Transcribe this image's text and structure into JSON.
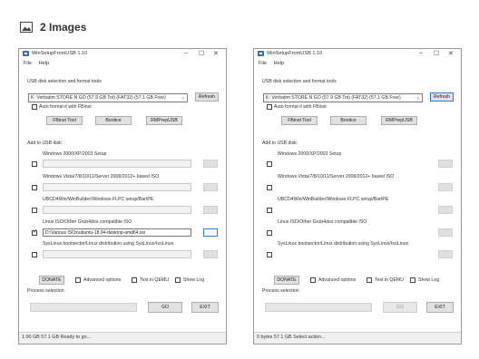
{
  "header": {
    "title": "2 Images",
    "icon": "image-gallery-icon"
  },
  "windows": [
    {
      "title": "WinSetupFromUSB 1.10",
      "menu": [
        "File",
        "Help"
      ],
      "disk_section_label": "USB disk selection and format tools",
      "disk_value": "K: Verbatim STORE N GO (57.9 GB Tot) (FAT32) (57.1 GB Free)",
      "refresh": "Refresh",
      "auto_format": "Auto format it with FBinst",
      "tools": [
        "FBinst Tool",
        "Bootice",
        "RMPrepUSB"
      ],
      "add_label": "Add to USB disk:",
      "options": [
        {
          "label": "Windows 2000/XP/2003 Setup",
          "value": "",
          "checked": false
        },
        {
          "label": "Windows Vista/7/8/10/11/Server 2008/2012+ based ISO",
          "value": "",
          "checked": false
        },
        {
          "label": "UBCD4Win/WinBuilder/Windows FLPC setup/BartPE",
          "value": "",
          "checked": false
        },
        {
          "label": "Linux ISO/Other Grub4dos compatible ISO",
          "value": "D:\\Various ISOs\\ubuntu-18.04-desktop-amd64.iso",
          "checked": true
        },
        {
          "label": "SysLinux bootsector/Linux distribution using SysLinux/IsoLinux",
          "value": "",
          "checked": false
        }
      ],
      "donate": "DONATE",
      "advanced": "Advanced options",
      "test_qemu": "Test in QEMU",
      "show_log": "Show Log",
      "process_label": "Process selection",
      "go": "GO",
      "exit": "EXIT",
      "status": "1.00 GB  57.1 GB  Ready to go..."
    },
    {
      "title": "WinSetupFromUSB 1.10",
      "menu": [
        "File",
        "Help"
      ],
      "disk_section_label": "USB disk selection and format tools",
      "disk_value": "K: Verbatim STORE N GO (57.9 GB Tot) (FAT32) (57.1 GB Free)",
      "refresh": "Refresh",
      "auto_format": "Auto format it with FBinst",
      "tools": [
        "FBinst Tool",
        "Bootice",
        "RMPrepUSB"
      ],
      "add_label": "Add to USB disk:",
      "options": [
        {
          "label": "Windows 2000/XP/2003 Setup",
          "value": "",
          "checked": false
        },
        {
          "label": "Windows Vista/7/8/10/11/Server 2008/2012+ based ISO",
          "value": "",
          "checked": false
        },
        {
          "label": "UBCD4Win/WinBuilder/Windows FLPC setup/BartPE",
          "value": "",
          "checked": false
        },
        {
          "label": "Linux ISO/Other Grub4dos compatible ISO",
          "value": "",
          "checked": false
        },
        {
          "label": "SysLinux bootsector/Linux distribution using SysLinux/IsoLinux",
          "value": "",
          "checked": false
        }
      ],
      "donate": "DONATE",
      "advanced": "Advanced options",
      "test_qemu": "Test in QEMU",
      "show_log": "Show Log",
      "process_label": "Process selection",
      "go": "GO",
      "exit": "EXIT",
      "status": "0 bytes  57.1 GB  Select action..."
    }
  ]
}
